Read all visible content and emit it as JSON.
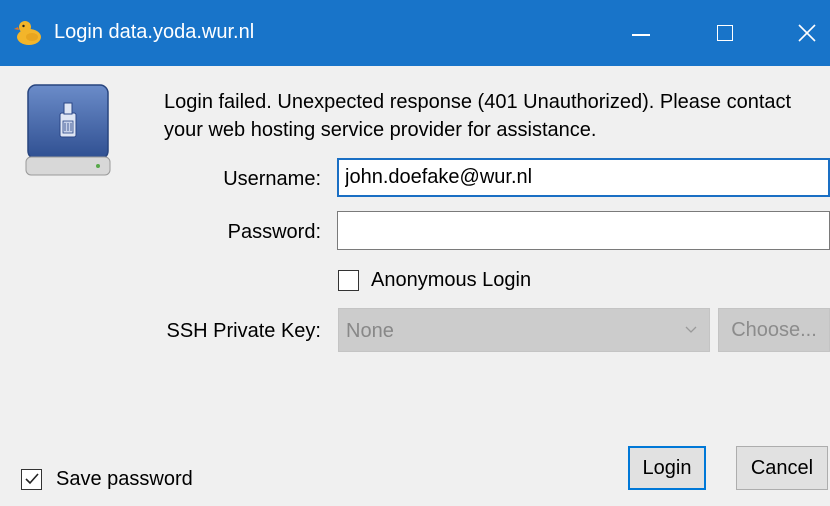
{
  "window": {
    "title": "Login data.yoda.wur.nl",
    "icon": "duck-icon",
    "controls": [
      "minimize-icon",
      "maximize-icon",
      "close-icon"
    ]
  },
  "message": "Login failed. Unexpected response (401 Unauthorized). Please contact your web hosting service provider for assistance.",
  "form": {
    "username_label": "Username:",
    "username_value": "john.doefake@wur.nl",
    "password_label": "Password:",
    "password_value": "",
    "anonymous_label": "Anonymous Login",
    "anonymous_checked": false,
    "ssh_label": "SSH Private Key:",
    "ssh_value": "None",
    "choose_label": "Choose..."
  },
  "footer": {
    "save_password_label": "Save password",
    "save_password_checked": true,
    "login_label": "Login",
    "cancel_label": "Cancel"
  },
  "colors": {
    "titlebar": "#1874c9",
    "focus_border": "#1a6fc4",
    "default_button_border": "#0078d7"
  }
}
